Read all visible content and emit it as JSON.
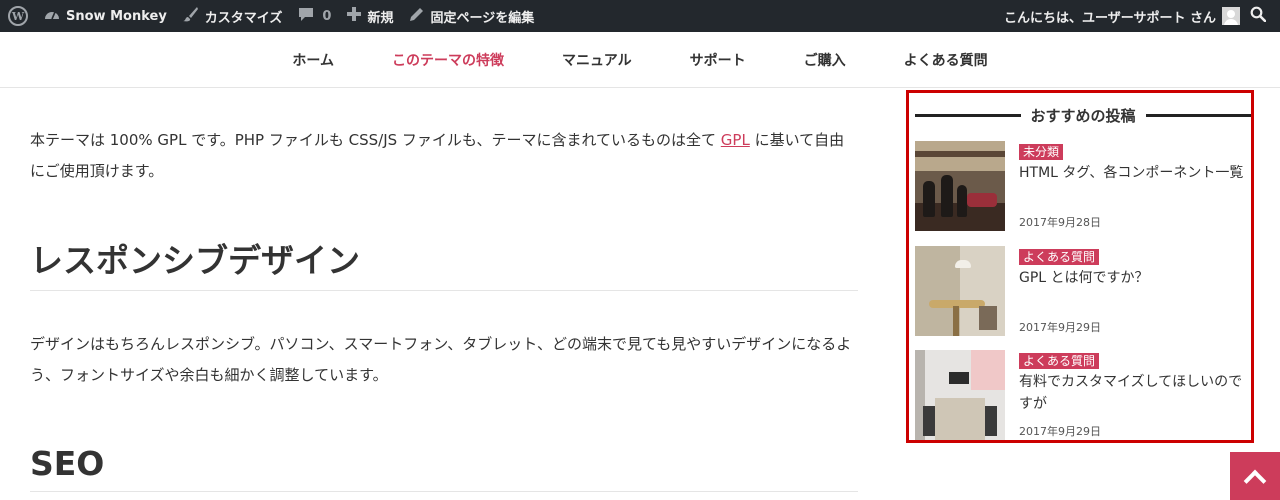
{
  "adminbar": {
    "site_name": "Snow Monkey",
    "customize": "カスタマイズ",
    "comments_count": "0",
    "new": "新規",
    "edit_page": "固定ページを編集",
    "greeting": "こんにちは、ユーザーサポート さん"
  },
  "nav": {
    "items": [
      "ホーム",
      "このテーマの特徴",
      "マニュアル",
      "サポート",
      "ご購入",
      "よくある質問"
    ],
    "current_index": 1
  },
  "content": {
    "p1_before_link": "本テーマは 100% GPL です。PHP ファイルも CSS/JS ファイルも、テーマに含まれているものは全て ",
    "p1_link": "GPL",
    "p1_after_link": " に基いて自由にご使用頂けます。",
    "h2_responsive": "レスポンシブデザイン",
    "p2": "デザインはもちろんレスポンシブ。パソコン、スマートフォン、タブレット、どの端末で見ても見やすいデザインになるよう、フォントサイズや余白も細かく調整しています。",
    "h2_seo": "SEO"
  },
  "sidebar": {
    "title": "おすすめの投稿",
    "posts": [
      {
        "category": "未分類",
        "title": "HTML タグ、各コンポーネント一覧",
        "date": "2017年9月28日"
      },
      {
        "category": "よくある質問",
        "title": "GPL とは何ですか？",
        "date": "2017年9月29日"
      },
      {
        "category": "よくある質問",
        "title": "有料でカスタマイズしてほしいのですが",
        "date": "2017年9月29日"
      }
    ]
  },
  "colors": {
    "accent": "#cd3c5b",
    "adminbar_bg": "#23282d",
    "highlight_border": "#cc0000"
  },
  "icons": {
    "wordpress": "wordpress-logo-icon",
    "site": "dashboard-icon",
    "customize": "brush-icon",
    "comments": "comment-bubble-icon",
    "new": "plus-icon",
    "edit": "pencil-icon",
    "search": "search-icon",
    "pagetop": "chevron-up-icon"
  }
}
